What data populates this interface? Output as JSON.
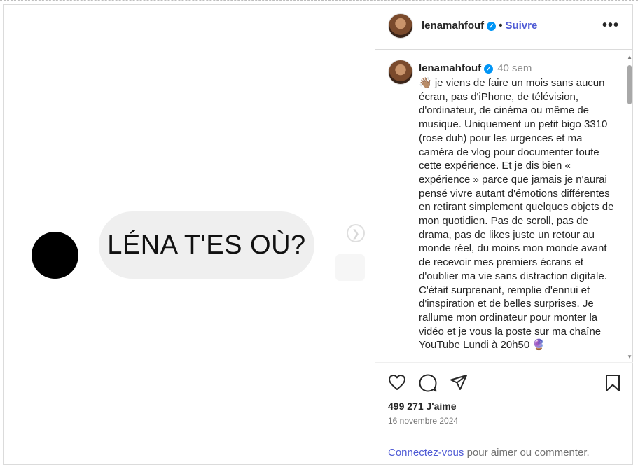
{
  "media": {
    "bubble_text": "LÉNA T'ES OÙ?"
  },
  "header": {
    "username": "lenamahfouf",
    "separator": "•",
    "follow_label": "Suivre",
    "more_label": "•••"
  },
  "caption": {
    "username": "lenamahfouf",
    "time_ago": "40 sem",
    "text": "👋🏽 je viens de faire un mois sans aucun écran, pas d'iPhone, de télévision, d'ordinateur, de cinéma ou même de musique. Uniquement un petit bigo 3310 (rose duh) pour les urgences et ma caméra de vlog pour documenter toute cette expérience. Et je dis bien « expérience » parce que jamais je n'aurai pensé vivre autant d'émotions différentes en retirant simplement quelques objets de mon quotidien. Pas de scroll, pas de drama, pas de likes juste un retour au monde réel, du moins mon monde avant de recevoir mes premiers écrans et d'oublier ma vie sans distraction digitale. C'était surprenant, remplie d'ennui et d'inspiration et de belles surprises. Je rallume mon ordinateur pour monter la vidéo et je vous la poste sur ma chaîne YouTube Lundi à 20h50 🔮"
  },
  "actions": {
    "likes": "499 271 J'aime",
    "date": "16 novembre 2024",
    "login_link": "Connectez-vous",
    "login_rest": " pour aimer ou commenter."
  },
  "icons": {
    "like": "heart-icon",
    "comment": "comment-icon",
    "share": "share-icon",
    "save": "bookmark-icon",
    "verified": "verified-badge-icon",
    "next": "chevron-right-icon"
  },
  "colors": {
    "accent": "#4f5bd5",
    "verified": "#0095f6",
    "border": "#dbdbdb"
  }
}
